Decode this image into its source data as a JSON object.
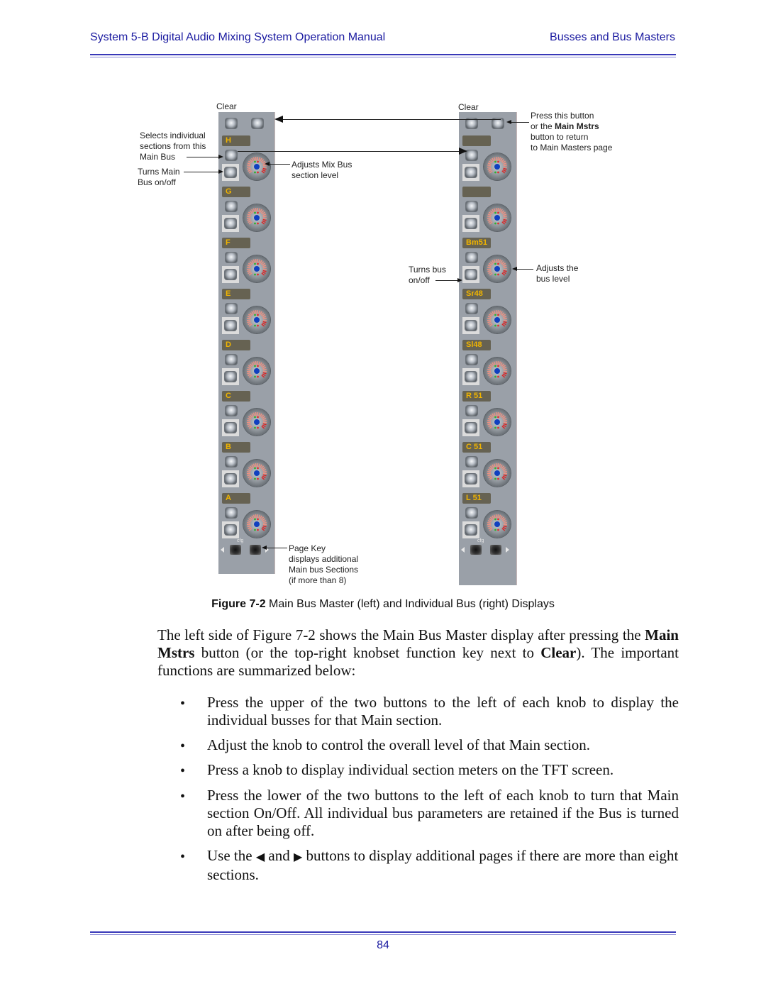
{
  "header": {
    "title": "System 5-B Digital Audio Mixing System Operation Manual",
    "section": "Busses and Bus Masters"
  },
  "figure": {
    "left_panel": {
      "clear_label": "Clear",
      "sections": [
        "H",
        "G",
        "F",
        "E",
        "D",
        "C",
        "B",
        "A"
      ],
      "cfg_label": "cfg"
    },
    "right_panel": {
      "clear_label": "Clear",
      "sections": [
        "",
        "",
        "Bm51",
        "Sr48",
        "Sl48",
        "R 51",
        "C 51",
        "L 51"
      ],
      "cfg_label": "cfg"
    },
    "annotations": {
      "selects_individual": [
        "Selects individual",
        "sections from this",
        "Main Bus"
      ],
      "turns_main": [
        "Turns Main",
        "Bus  on/off"
      ],
      "adjusts_mix": [
        "Adjusts Mix Bus",
        "section level"
      ],
      "page_key": [
        "Page Key",
        "displays additional",
        "Main bus Sections",
        "(if more than 8)"
      ],
      "press_button_1": "Press this button",
      "press_button_2a": "or the ",
      "press_button_2b": "Main  Mstrs",
      "press_button_3": "button to return",
      "press_button_4": "to Main  Masters  page",
      "turns_bus": [
        "Turns bus",
        "on/off"
      ],
      "adjusts_bus": [
        "Adjusts the",
        "bus level"
      ]
    },
    "caption_label": "Figure 7-2",
    "caption_text": " Main Bus Master (left) and Individual Bus (right) Displays"
  },
  "body": {
    "para_1": "The left side of Figure 7-2 shows the Main Bus Master display after pressing the ",
    "para_bold_1": "Main Mstrs",
    "para_2": " button (or the top-right knobset function key next to ",
    "para_bold_2": "Clear",
    "para_3": "). The important functions are summarized below:",
    "bullet_char": "•",
    "bullets": [
      "Press the upper of the two buttons to the left of each knob to display the individual busses for that Main section.",
      "Adjust the knob to control the overall level of that Main section.",
      "Press a knob to display individual section meters on the TFT screen.",
      "Press the lower of the two buttons to the left of each knob to turn that Main section On/Off. All individual bus parameters are retained if the Bus is turned on after being off."
    ],
    "bullet_5a": "Use the ",
    "bullet_5_left": "◀",
    "bullet_5b": " and ",
    "bullet_5_right": "▶",
    "bullet_5c": " buttons to display additional pages if there are more than eight sections."
  },
  "footer": {
    "page_number": "84"
  },
  "colors": {
    "header_blue": "#1a1aa0",
    "panel_gray": "#9aa0a8",
    "label_box": "#666252",
    "label_text": "#f0b400"
  }
}
